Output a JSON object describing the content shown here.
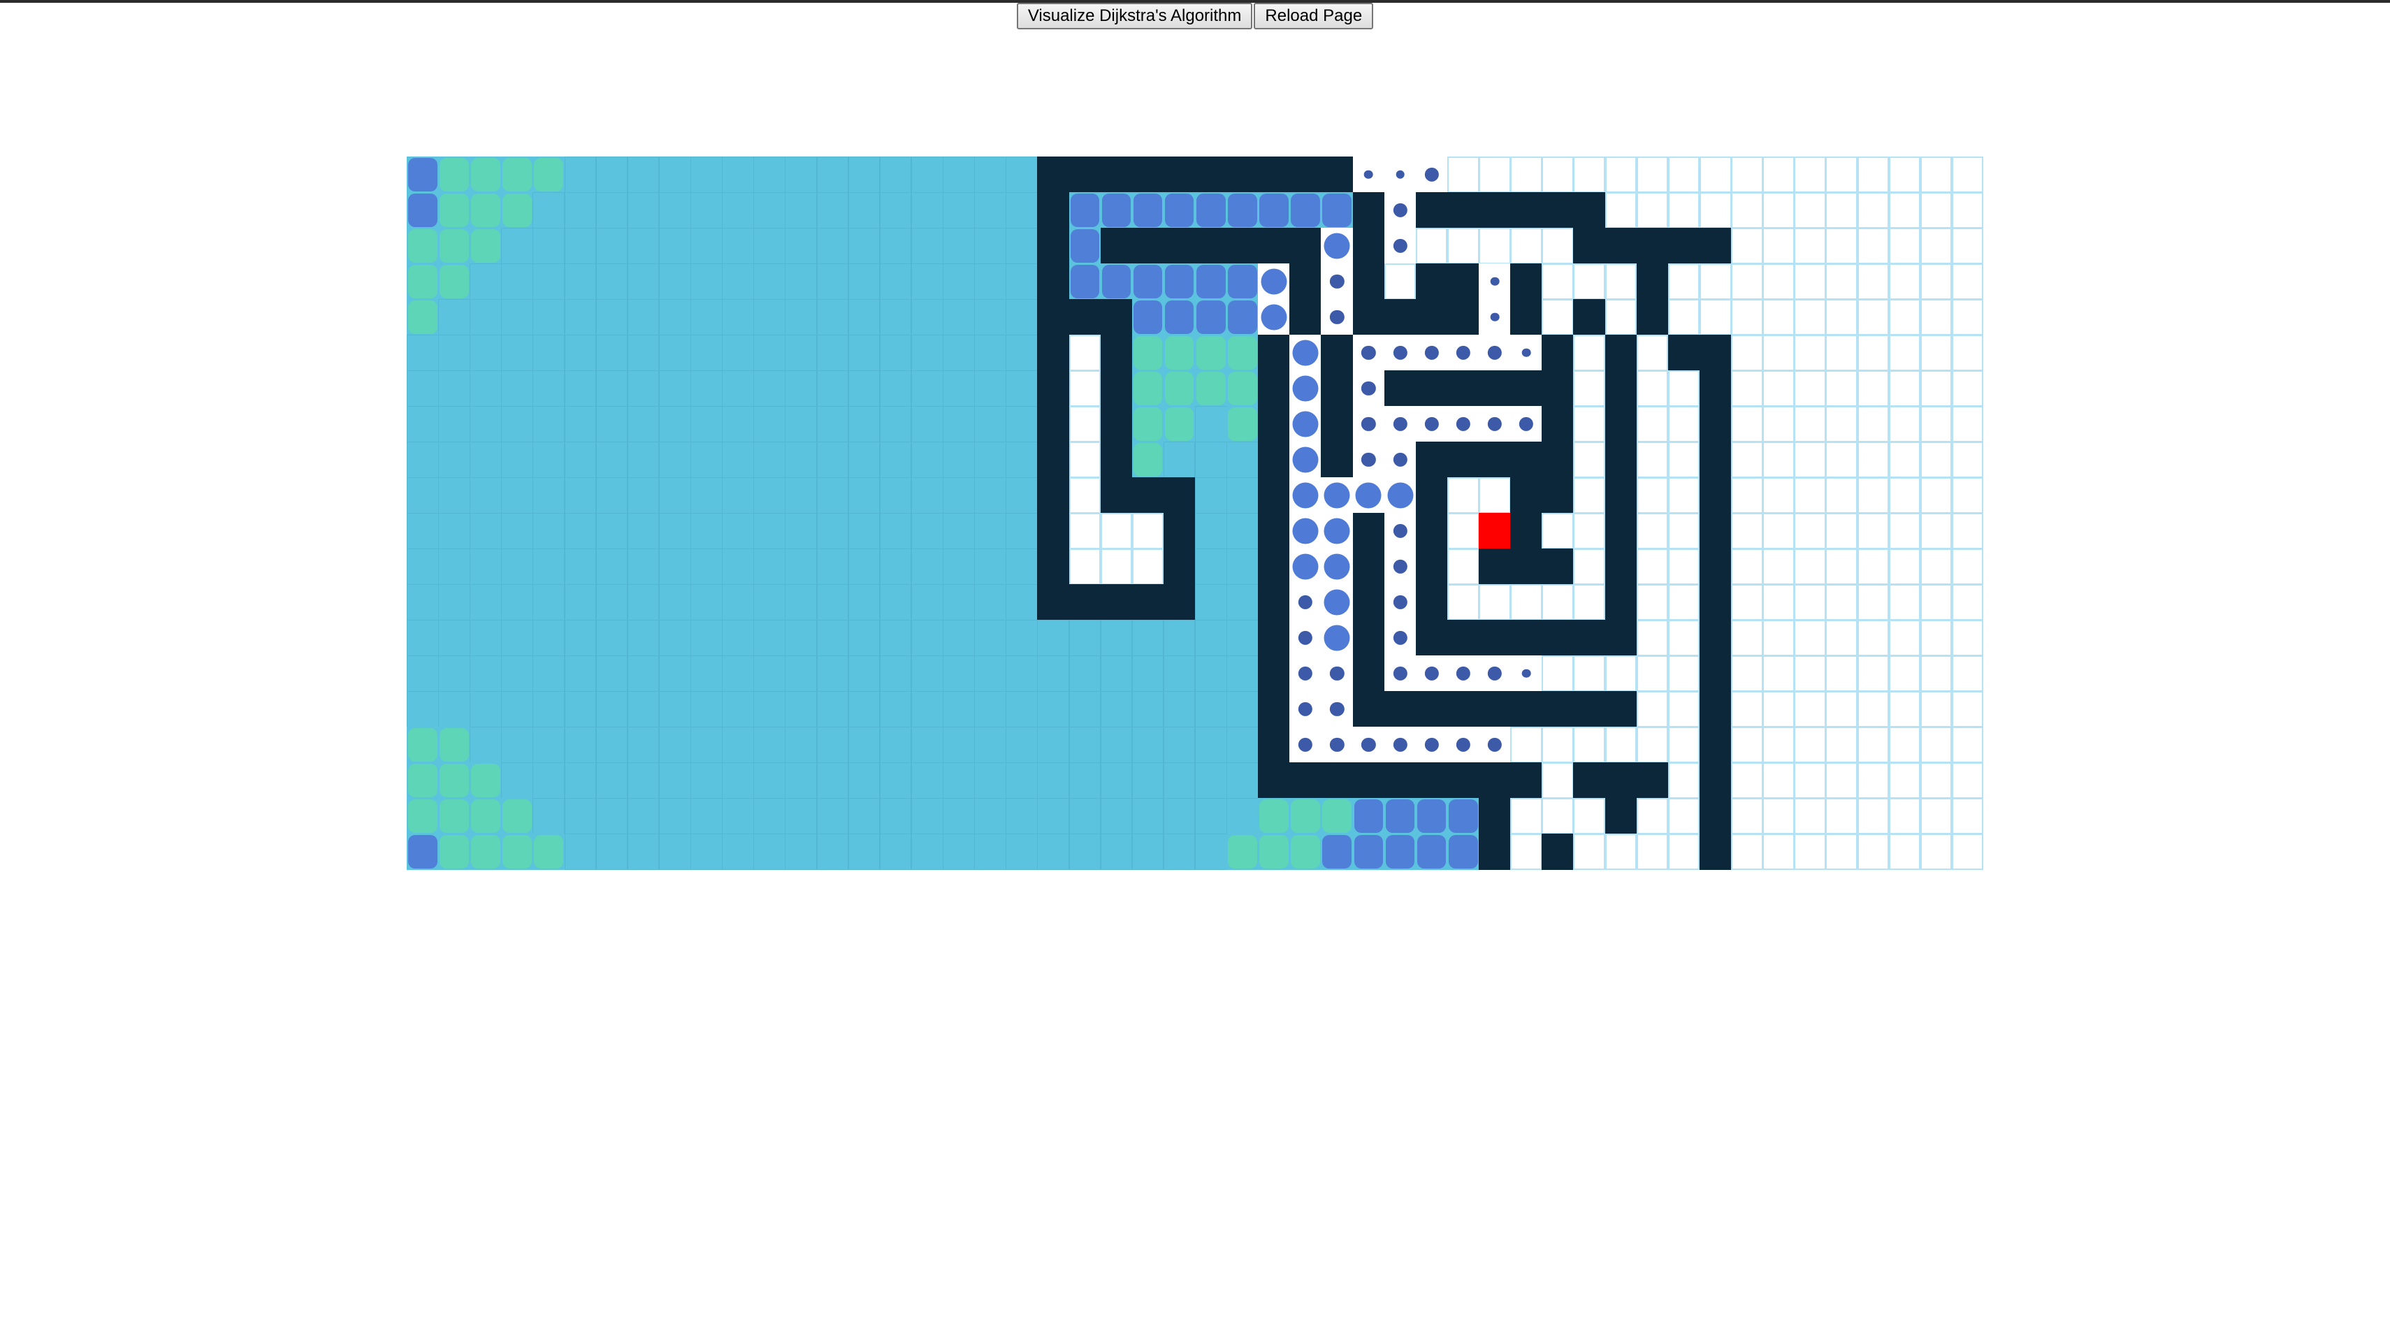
{
  "controls": {
    "visualize_label": "Visualize Dijkstra's Algorithm",
    "reload_label": "Reload Page"
  },
  "colors": {
    "wall": "#0c2739",
    "visited": "#5bc3dd",
    "frontier_blue": "#4f7bd6",
    "frontier_teal": "#5fd8b0",
    "path_dot": "#3d5aa8",
    "target": "#ff0000",
    "empty_border": "#b6e2f5"
  },
  "grid": {
    "rows": 20,
    "cols": 50,
    "legend": {
      "W": "wall",
      "V": "visited",
      ".": "empty",
      "B": "frontier-node",
      "G": "frontier-node-teal",
      "s": "dot-small",
      "m": "dot-medium",
      "l": "dot-large",
      "T": "target"
    },
    "cells": [
      "BGGGGVVVVVVVVVVVVVVVWWWWWWWWWWssm.................",
      "BGGGVVVVVVVVVVVVVVVVWBBBBBBBBBWmWWWWWW............",
      "GGGVVVVVVVVVVVVVVVVVWBWWWWWWWlWm.....WWWWW........",
      "GGVVVVVVVVVVVVVVVVVVWBBBBBBlWmW.WWsW...W..........",
      "GVVVVVVVVVVVVVVVVVVVWWWBBBBlWmWWWWsW.W.W..........",
      "VVVVVVVVVVVVVVVVVVVVW.WGGGGWlWmmmmmsW.W.WW........",
      "VVVVVVVVVVVVVVVVVVVVW.WGGGGWlWmWWWWWW.W..W........",
      "VVVVVVVVVVVVVVVVVVVVW.WGGVGWlWmmmmmmW.W..W........",
      "VVVVVVVVVVVVVVVVVVVVW.WGVVVWlWmmWWWWW.W..W........",
      "VVVVVVVVVVVVVVVVVVVVW.WWWVVWllllW..WW.W..W........",
      "VVVVVVVVVVVVVVVVVVVVW...WVVWllWmW.TW..W..W........",
      "VVVVVVVVVVVVVVVVVVVVW...WVVWllWmW.WWW.W..W........",
      "VVVVVVVVVVVVVVVVVVVVWWWWWVVWmlWmW.....W..W........",
      "VVVVVVVVVVVVVVVVVVVVVVVVVVVWmlWmWWWWWWW..W........",
      "VVVVVVVVVVVVVVVVVVVVVVVVVVVWmmWmmmms.....W........",
      "VVVVVVVVVVVVVVVVVVVVVVVVVVVWmmWWWWWWWWW..W........",
      "GGVVVVVVVVVVVVVVVVVVVVVVVVVWmmmmmmm......W........",
      "GGGVVVVVVVVVVVVVVVVVVVVVVVVWWWWWWWWW.WWW.W........",
      "GGGGVVVVVVVVVVVVVVVVVVVVVVVGGGBBBBW...W..W........",
      "BGGGGVVVVVVVVVVVVVVVVVVVVVGGGBBBBBW.W....W........"
    ]
  }
}
